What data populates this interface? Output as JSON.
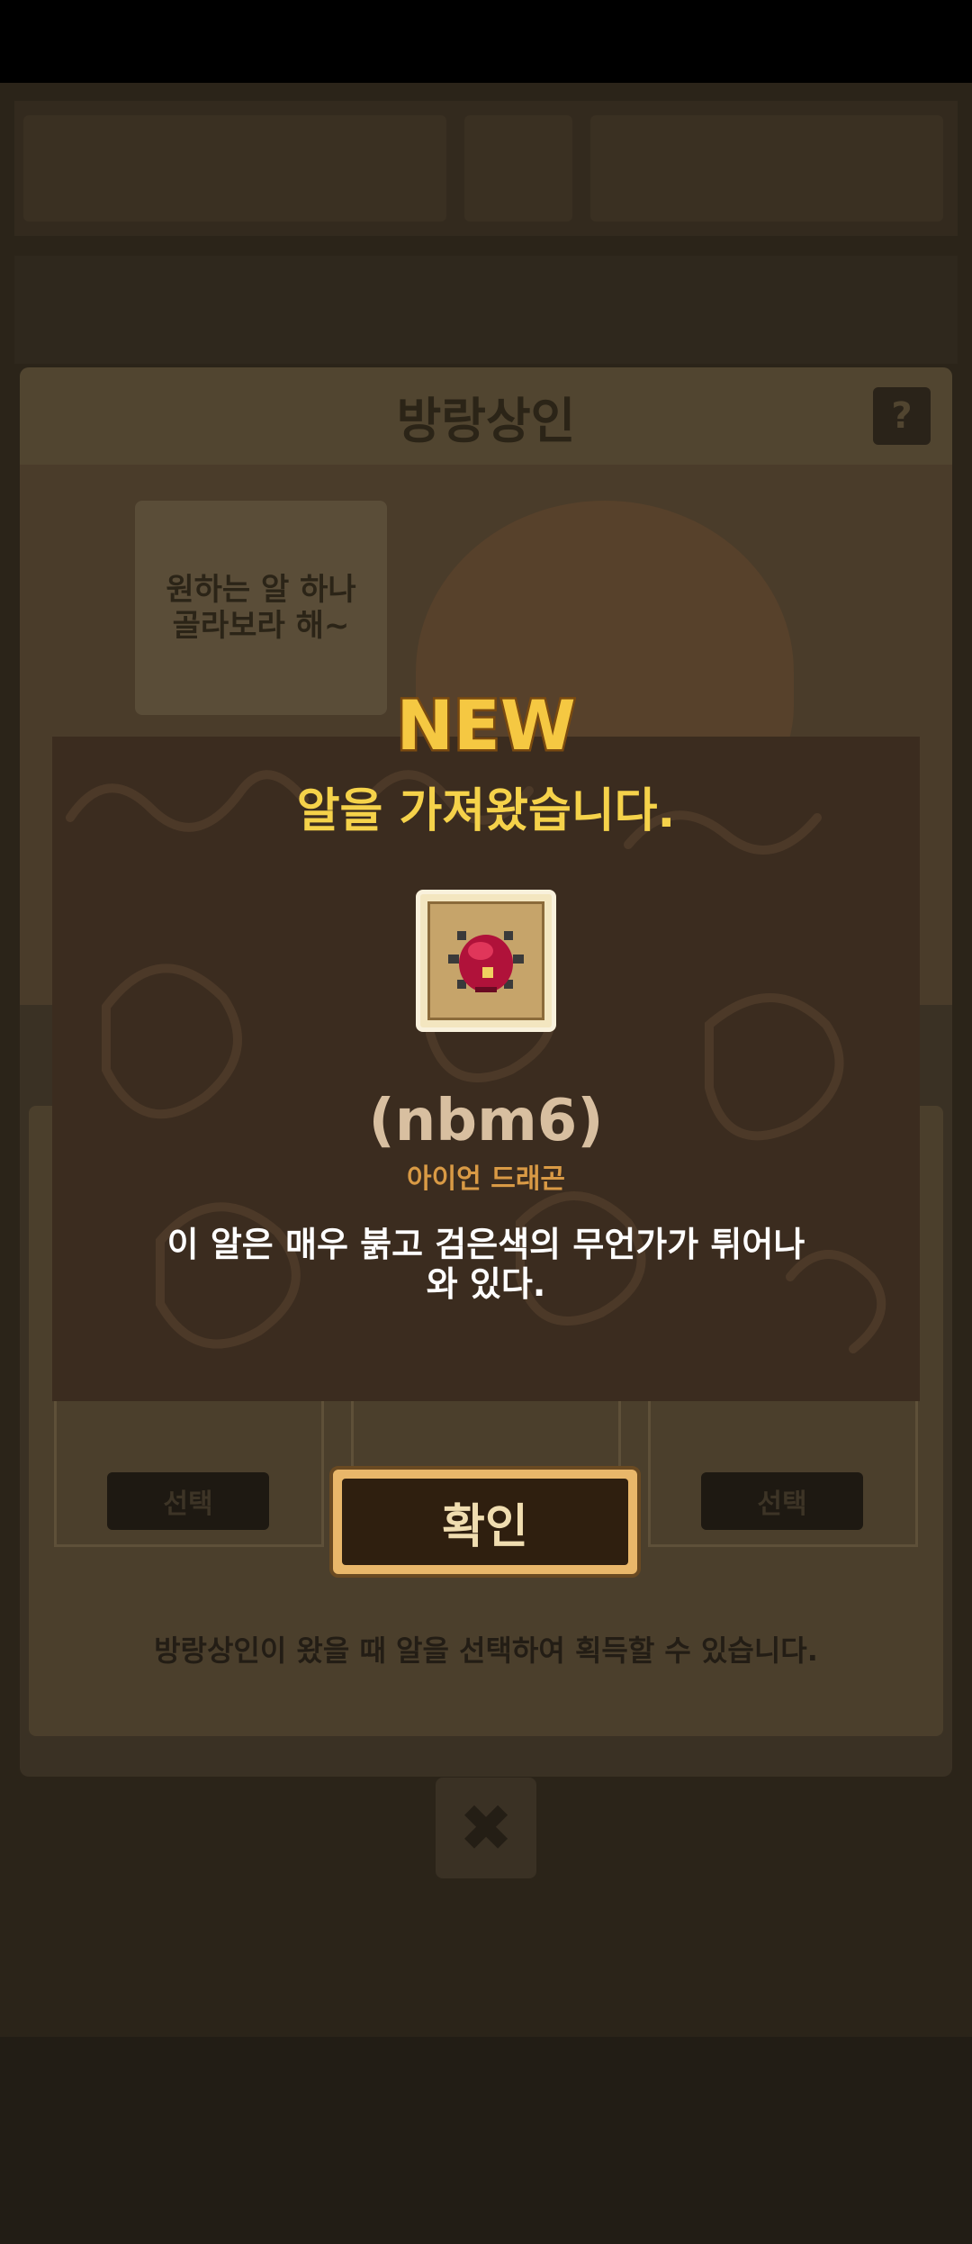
{
  "background": {
    "panel_title": "방랑상인",
    "help_label": "?",
    "merchant_speech": "원하는 알 하나\n골라보라 해~",
    "select_label": "선택",
    "info_text": "방랑상인이 왔을 때 알을 선택하여 획득할 수 있습니다.",
    "close_label": "✖"
  },
  "dialog": {
    "badge": "NEW",
    "title": "알을 가져왔습니다.",
    "egg_name": "(nbm6)",
    "egg_species": "아이언 드래곤",
    "egg_description": "이 알은 매우 붉고 검은색의 무언가가 튀어나와 있다.",
    "confirm_label": "확인"
  },
  "colors": {
    "dialog_bg": "#3b2c1f",
    "title": "#f5d24a",
    "egg_name": "#d8bfa0",
    "species": "#d99a45",
    "button_border": "#e9b76a",
    "button_fill": "#2f1f0f"
  }
}
